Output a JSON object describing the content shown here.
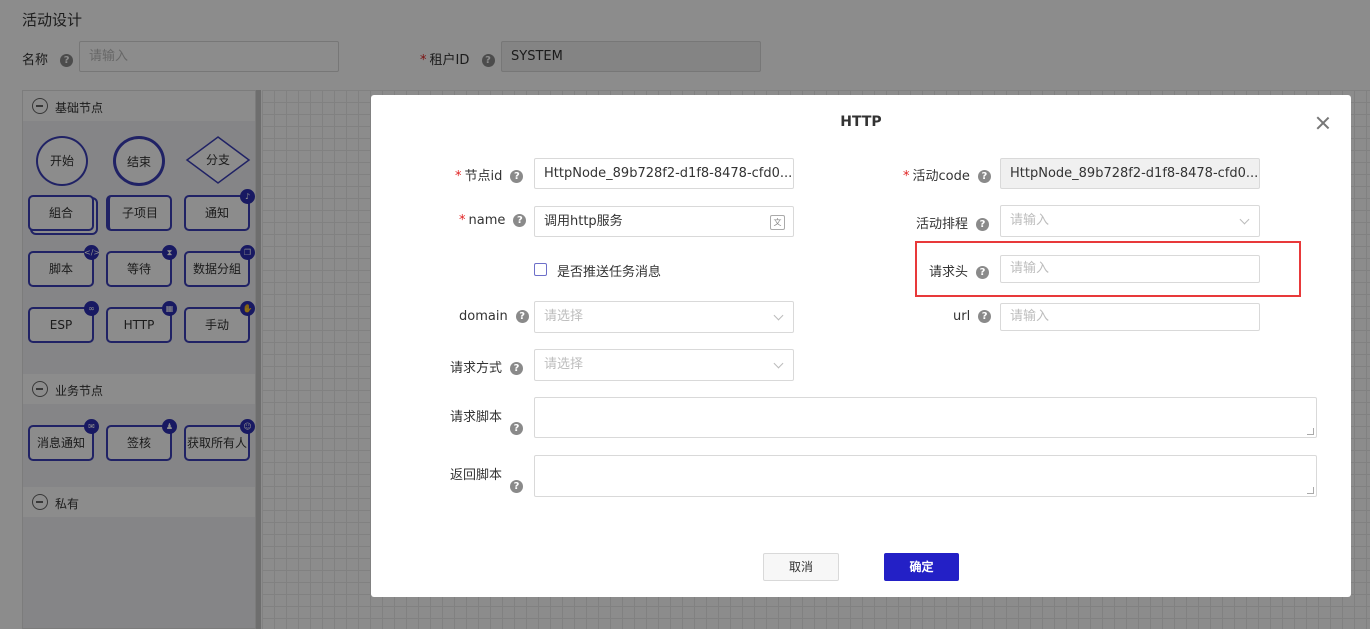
{
  "page": {
    "title": "活动设计",
    "name_label": "名称",
    "name_placeholder": "请输入",
    "tenant_label": "租户ID",
    "tenant_value": "SYSTEM"
  },
  "palette": {
    "basic_section": "基础节点",
    "business_section": "业务节点",
    "private_section": "私有",
    "basic_nodes": {
      "start": "开始",
      "end": "结束",
      "branch": "分支",
      "combine": "組合",
      "subproject": "子项目",
      "notify": "通知",
      "script": "脚本",
      "wait": "等待",
      "data_group": "数据分組",
      "esp": "ESP",
      "http": "HTTP",
      "manual": "手动"
    },
    "business_nodes": {
      "message_notify": "消息通知",
      "approve": "签核",
      "get_owner": "获取所有人"
    }
  },
  "modal": {
    "title": "HTTP",
    "node_id_label": "节点id",
    "node_id_value": "HttpNode_89b728f2-d1f8-8478-cfd0...",
    "activity_code_label": "活动code",
    "activity_code_value": "HttpNode_89b728f2-d1f8-8478-cfd0...",
    "name_label": "name",
    "name_value": "调用http服务",
    "schedule_label": "活动排程",
    "schedule_placeholder": "请输入",
    "push_label": "是否推送任务消息",
    "headers_label": "请求头",
    "headers_placeholder": "请输入",
    "domain_label": "domain",
    "domain_placeholder": "请选择",
    "url_label": "url",
    "url_placeholder": "请输入",
    "method_label": "请求方式",
    "method_placeholder": "请选择",
    "request_script_label": "请求脚本",
    "return_script_label": "返回脚本",
    "cancel_label": "取消",
    "ok_label": "确定"
  },
  "colors": {
    "primary": "#2320c6",
    "highlight": "#e8393a",
    "node_border": "#3b3fb8"
  }
}
